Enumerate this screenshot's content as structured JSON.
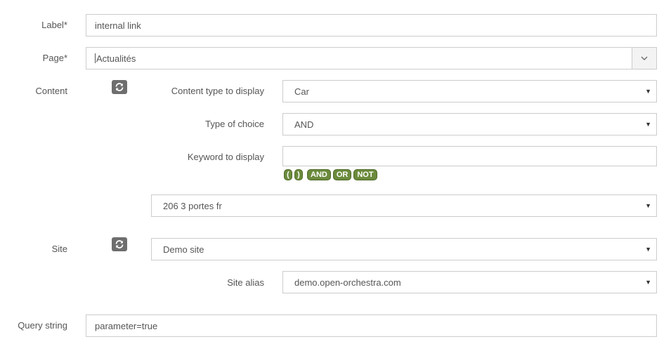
{
  "form": {
    "label": {
      "label": "Label*",
      "value": "internal link"
    },
    "page": {
      "label": "Page*",
      "value": "Actualités"
    },
    "content": {
      "label": "Content",
      "refresh_icon": "refresh-icon",
      "content_type": {
        "label": "Content type to display",
        "value": "Car"
      },
      "type_of_choice": {
        "label": "Type of choice",
        "value": "AND"
      },
      "keyword": {
        "label": "Keyword to display",
        "value": "",
        "buttons": [
          "(",
          ")",
          "AND",
          "OR",
          "NOT"
        ]
      },
      "selected_content": "206 3 portes fr"
    },
    "site": {
      "label": "Site",
      "refresh_icon": "refresh-icon",
      "value": "Demo site",
      "alias": {
        "label": "Site alias",
        "value": "demo.open-orchestra.com"
      }
    },
    "query_string": {
      "label": "Query string",
      "value": "parameter=true"
    }
  },
  "colors": {
    "keyword_button": "#6b8a3c",
    "refresh_button": "#6e6e6e",
    "border": "#cccccc"
  }
}
